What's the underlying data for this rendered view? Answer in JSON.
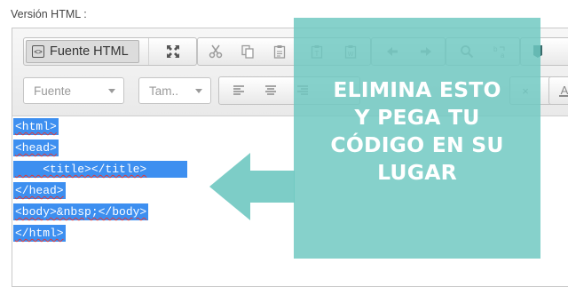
{
  "field_label": "Versión HTML :",
  "toolbar": {
    "source_button": "Fuente HTML",
    "font_combo": "Fuente",
    "size_combo": "Tam.."
  },
  "code_lines": [
    "<html>",
    "<head>",
    "    <title></title>",
    "</head>",
    "<body>&nbsp;</body>",
    "</html>"
  ],
  "overlay": {
    "lines": [
      "ELIMINA ESTO",
      "Y PEGA TU",
      "CÓDIGO EN SU",
      "LUGAR"
    ],
    "color": "#6fc8c1"
  },
  "icons": [
    "source-icon",
    "maximize-icon",
    "cut-icon",
    "copy-icon",
    "paste-icon",
    "paste-text-icon",
    "paste-word-icon",
    "undo-icon",
    "redo-icon",
    "find-icon",
    "replace-icon",
    "bookmark-icon",
    "align-left-icon",
    "align-center-icon",
    "align-right-icon",
    "remove-format-icon",
    "text-color-icon"
  ],
  "colors": {
    "selection": "#3d8ff0",
    "overlay": "#6fc8c1"
  }
}
